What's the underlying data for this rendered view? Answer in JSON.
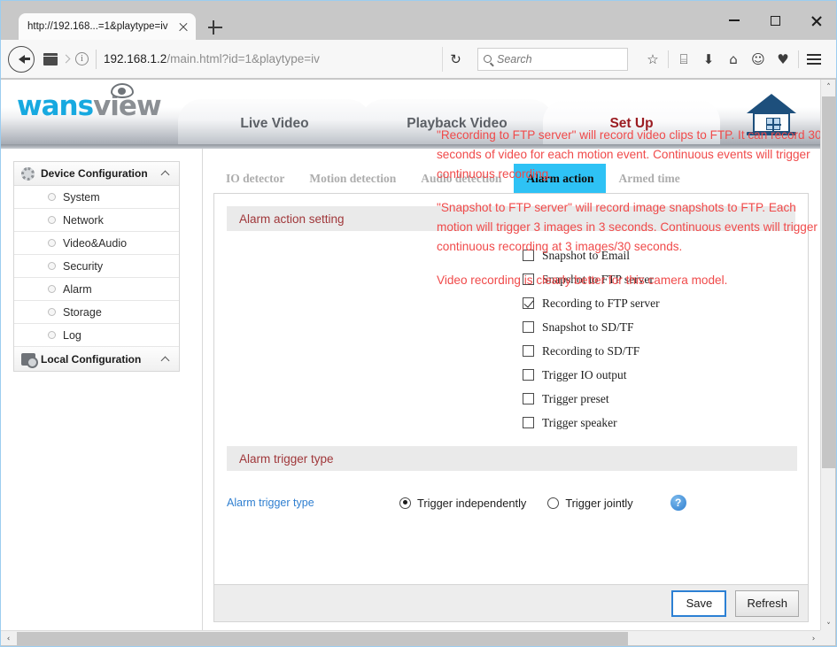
{
  "browser": {
    "tab_title": "http://192.168...=1&playtype=iv",
    "tab_close_label": "",
    "new_tab_label": "",
    "url_host": "192.168.1.2",
    "url_path": "/main.html?id=1&playtype=iv",
    "reload_glyph": "↻",
    "search_placeholder": "Search",
    "toolbar_icons": [
      {
        "name": "bookmark-star-icon",
        "glyph": "☆"
      },
      {
        "name": "library-icon",
        "glyph": "⌸"
      },
      {
        "name": "downloads-icon",
        "glyph": "⬇"
      },
      {
        "name": "home-icon",
        "glyph": "⌂"
      },
      {
        "name": "sync-account-icon",
        "glyph": "☺"
      },
      {
        "name": "pocket-icon",
        "glyph": "♥"
      }
    ],
    "window_controls": {
      "minimize": "—",
      "maximize": "□",
      "close": "✕"
    }
  },
  "site": {
    "logo_primary": "wans",
    "logo_secondary": "view",
    "nav_tabs": [
      {
        "label": "Live Video",
        "active": false
      },
      {
        "label": "Playback Video",
        "active": false
      },
      {
        "label": "Set Up",
        "active": true
      }
    ]
  },
  "sidebar": {
    "groups": [
      {
        "label": "Device Configuration",
        "icon": "gear-icon",
        "expanded": true,
        "items": [
          {
            "label": "System"
          },
          {
            "label": "Network"
          },
          {
            "label": "Video&Audio"
          },
          {
            "label": "Security"
          },
          {
            "label": "Alarm"
          },
          {
            "label": "Storage"
          },
          {
            "label": "Log"
          }
        ]
      },
      {
        "label": "Local Configuration",
        "icon": "computer-gear-icon",
        "expanded": true,
        "items": []
      }
    ]
  },
  "content": {
    "tabs": [
      {
        "label": "IO detector",
        "selected": false
      },
      {
        "label": "Motion detection",
        "selected": false
      },
      {
        "label": "Audio detection",
        "selected": false
      },
      {
        "label": "Alarm action",
        "selected": true
      },
      {
        "label": "Armed time",
        "selected": false
      }
    ],
    "alarm_action_section_title": "Alarm action setting",
    "checkboxes": [
      {
        "label": "Snapshot to Email",
        "checked": false
      },
      {
        "label": "Snapshot to FTP server",
        "checked": false
      },
      {
        "label": "Recording to FTP server",
        "checked": true
      },
      {
        "label": "Snapshot to SD/TF",
        "checked": false
      },
      {
        "label": "Recording to SD/TF",
        "checked": false
      },
      {
        "label": "Trigger IO output",
        "checked": false
      },
      {
        "label": "Trigger preset",
        "checked": false
      },
      {
        "label": "Trigger speaker",
        "checked": false
      }
    ],
    "notes": [
      "\"Recording to FTP server\" will record video clips to FTP. It can record 30-seconds of video for each motion event. Continuous events will trigger continuous recording.",
      "\"Snapshot to FTP server\" will record image snapshots to FTP. Each motion will trigger 3 images in 3 seconds. Continuous events will trigger continuous recording at 3 images/30 seconds.",
      "Video recording is clearly better for this camera model."
    ],
    "notes_color": "#f04a4a",
    "trigger_section_title": "Alarm trigger type",
    "trigger_field_label": "Alarm trigger type",
    "trigger_options": [
      {
        "label": "Trigger independently",
        "selected": true
      },
      {
        "label": "Trigger jointly",
        "selected": false
      }
    ],
    "help_glyph": "?",
    "save_label": "Save",
    "refresh_label": "Refresh"
  },
  "scrollbars": {
    "v_up_glyph": "˄",
    "v_down_glyph": "˅",
    "h_left_glyph": "‹",
    "h_right_glyph": "›"
  },
  "colors": {
    "tab_active_blue": "#2ec2f5",
    "section_title_red": "#a0373a",
    "note_red": "#f04a4a",
    "logo_blue": "#17a9e0",
    "link_blue": "#2f7fd0",
    "setup_red": "#9b1c22"
  }
}
